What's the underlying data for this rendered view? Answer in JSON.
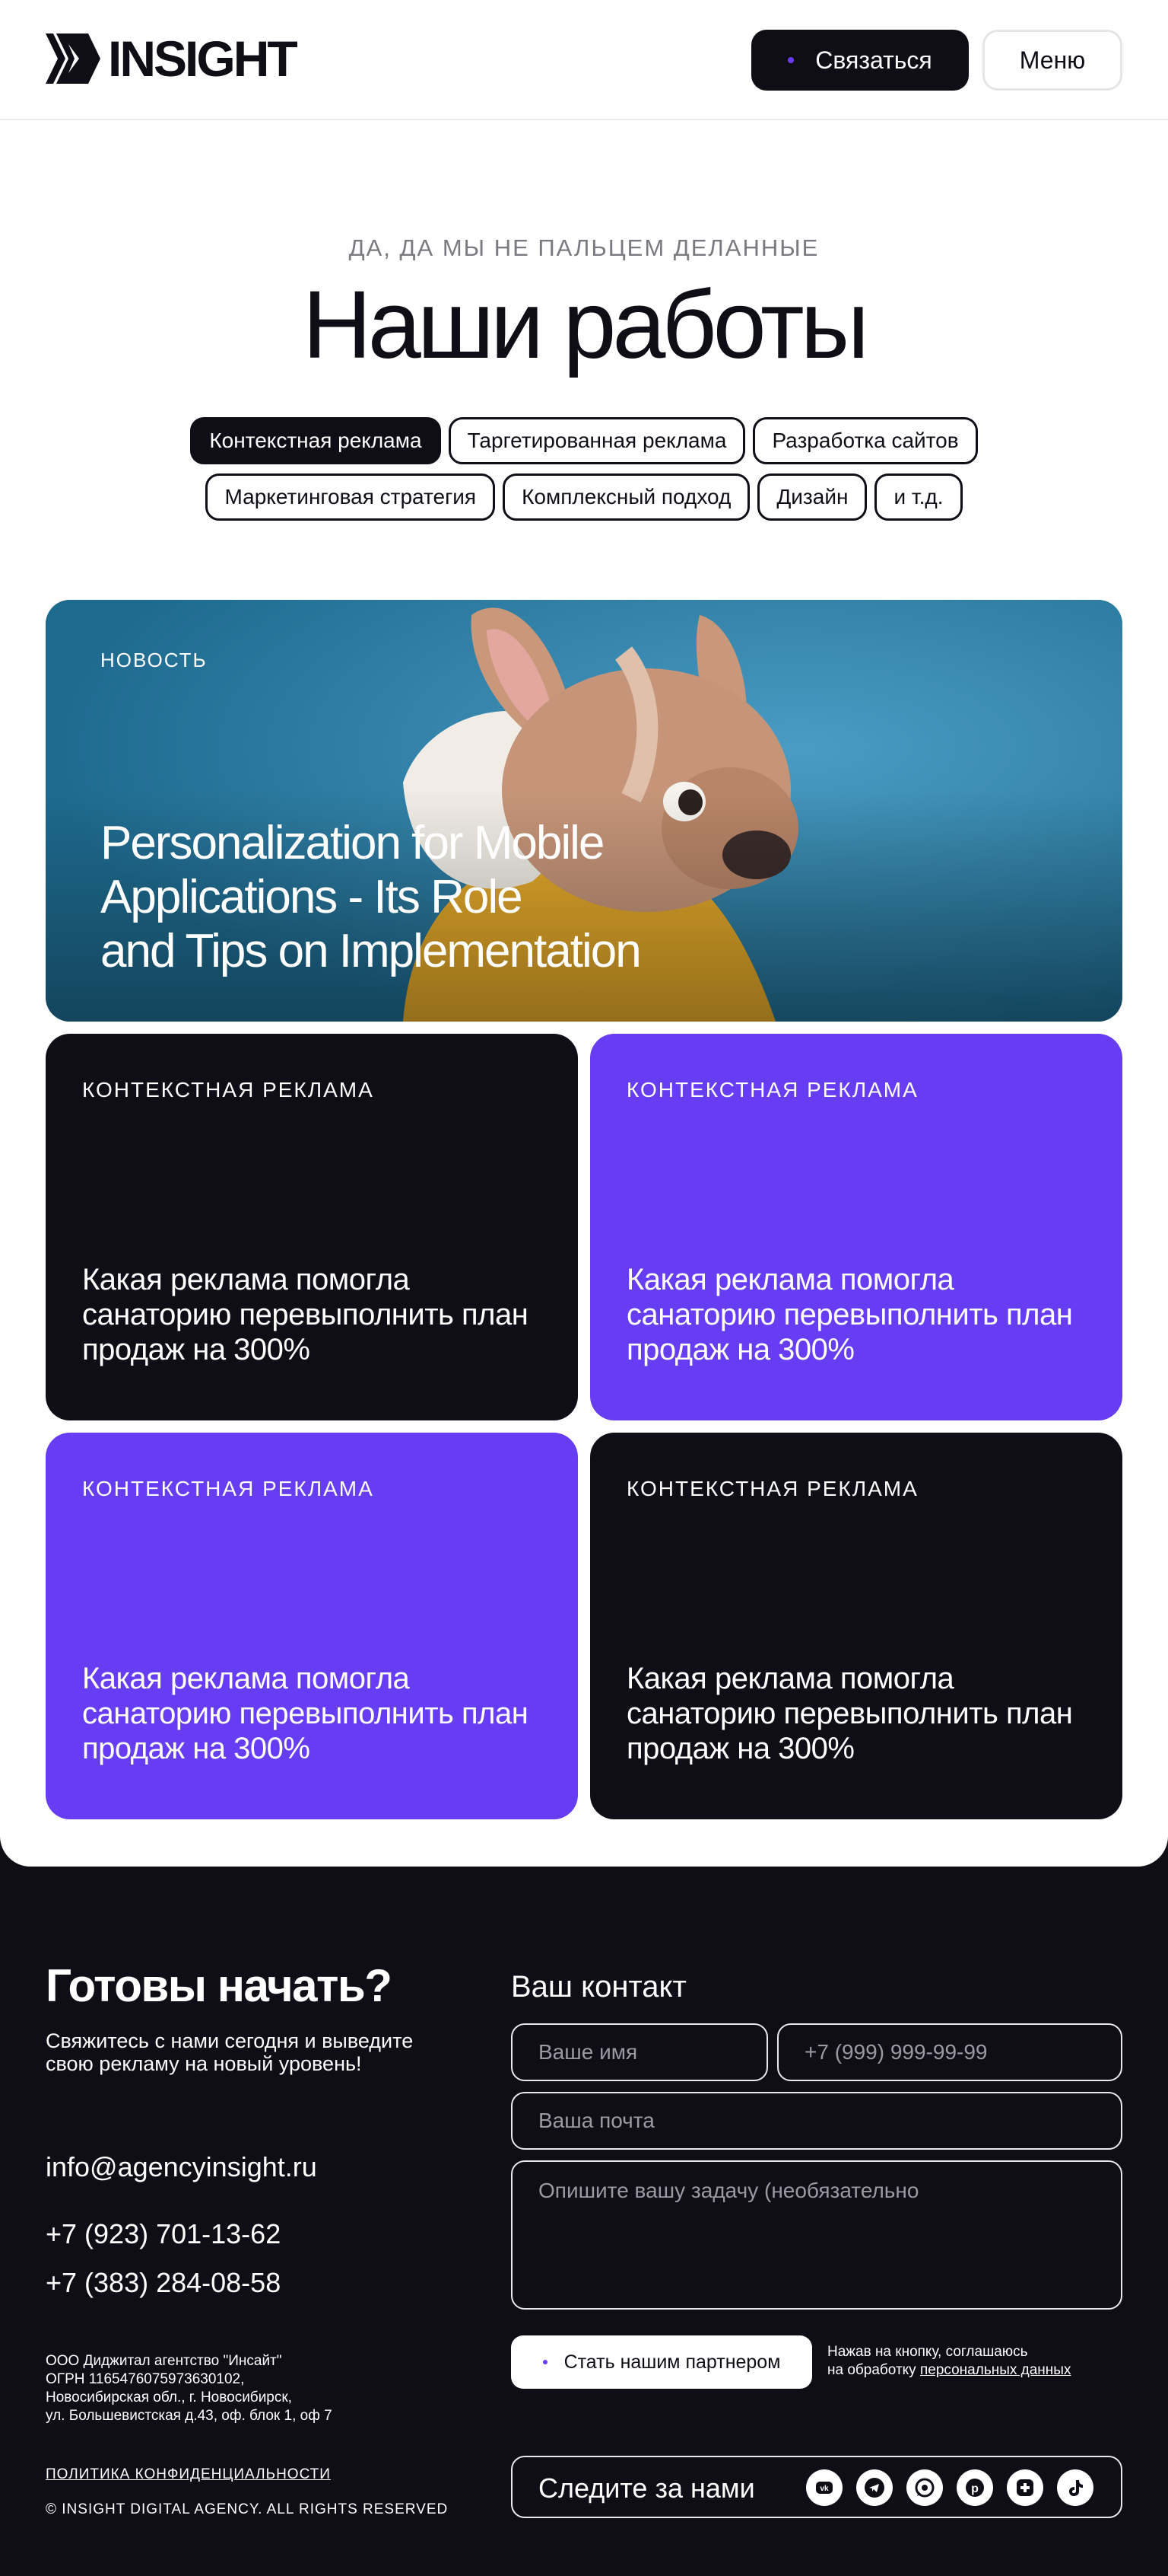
{
  "header": {
    "logo_text": "INSIGHT",
    "contact_button": "Связаться",
    "menu_button": "Меню"
  },
  "hero": {
    "eyebrow": "ДА, ДА МЫ НЕ ПАЛЬЦЕМ ДЕЛАННЫЕ",
    "title": "Наши работы"
  },
  "filters": {
    "row1": [
      "Контекстная реклама",
      "Таргетированная реклама",
      "Разработка сайтов"
    ],
    "row2": [
      "Маркетинговая стратегия",
      "Комплексный подход",
      "Дизайн",
      "и т.д."
    ],
    "active": "Контекстная реклама"
  },
  "featured": {
    "tag": "НОВОСТЬ",
    "title_line1": "Personalization for Mobile",
    "title_line2": "Applications - Its Role",
    "title_line3": "and Tips on Implementation"
  },
  "cards": [
    {
      "tag": "КОНТЕКСТНАЯ РЕКЛАМА",
      "title": "Какая реклама помогла санаторию перевыполнить план продаж на 300%",
      "theme": "dark"
    },
    {
      "tag": "КОНТЕКСТНАЯ РЕКЛАМА",
      "title": "Какая реклама помогла санаторию перевыполнить план продаж на 300%",
      "theme": "purple"
    },
    {
      "tag": "КОНТЕКСТНАЯ РЕКЛАМА",
      "title": "Какая реклама помогла санаторию перевыполнить план продаж на 300%",
      "theme": "purple"
    },
    {
      "tag": "КОНТЕКСТНАЯ РЕКЛАМА",
      "title": "Какая реклама помогла санаторию перевыполнить план продаж на 300%",
      "theme": "dark"
    }
  ],
  "footer": {
    "title": "Готовы начать?",
    "subtitle": "Свяжитесь с нами сегодня и выведите свою рекламу на новый уровень!",
    "email": "info@agencyinsight.ru",
    "phone1": "+7 (923) 701-13-62",
    "phone2": "+7 (383) 284-08-58",
    "legal_line1": "ООО Диджитал агентство \"Инсайт\"",
    "legal_line2": "ОГРН 1165476075973630102,",
    "legal_line3": "Новосибирская обл., г. Новосибирск,",
    "legal_line4": "ул. Большевистская д.43, оф. блок 1, оф 7",
    "policy": "ПОЛИТИКА КОНФИДЕНЦИАЛЬНОСТИ",
    "copyright": "© INSIGHT DIGITAL AGENCY. ALL RIGHTS RESERVED"
  },
  "form": {
    "title": "Ваш контакт",
    "name_placeholder": "Ваше имя",
    "phone_placeholder": "+7 (999) 999-99-99",
    "email_placeholder": "Ваша почта",
    "task_placeholder": "Опишите вашу задачу (необязательно",
    "submit": "Стать нашим партнером",
    "consent_line1": "Нажав на кнопку, соглашаюсь",
    "consent_line2": "на обработку",
    "consent_link": "персональных данных"
  },
  "social": {
    "label": "Следите за нами",
    "icons": [
      "vk-icon",
      "telegram-icon",
      "whatsapp-icon",
      "pinterest-icon",
      "plus-icon",
      "tiktok-icon"
    ]
  },
  "colors": {
    "dark": "#0f0e17",
    "purple": "#673df4",
    "white": "#ffffff"
  }
}
